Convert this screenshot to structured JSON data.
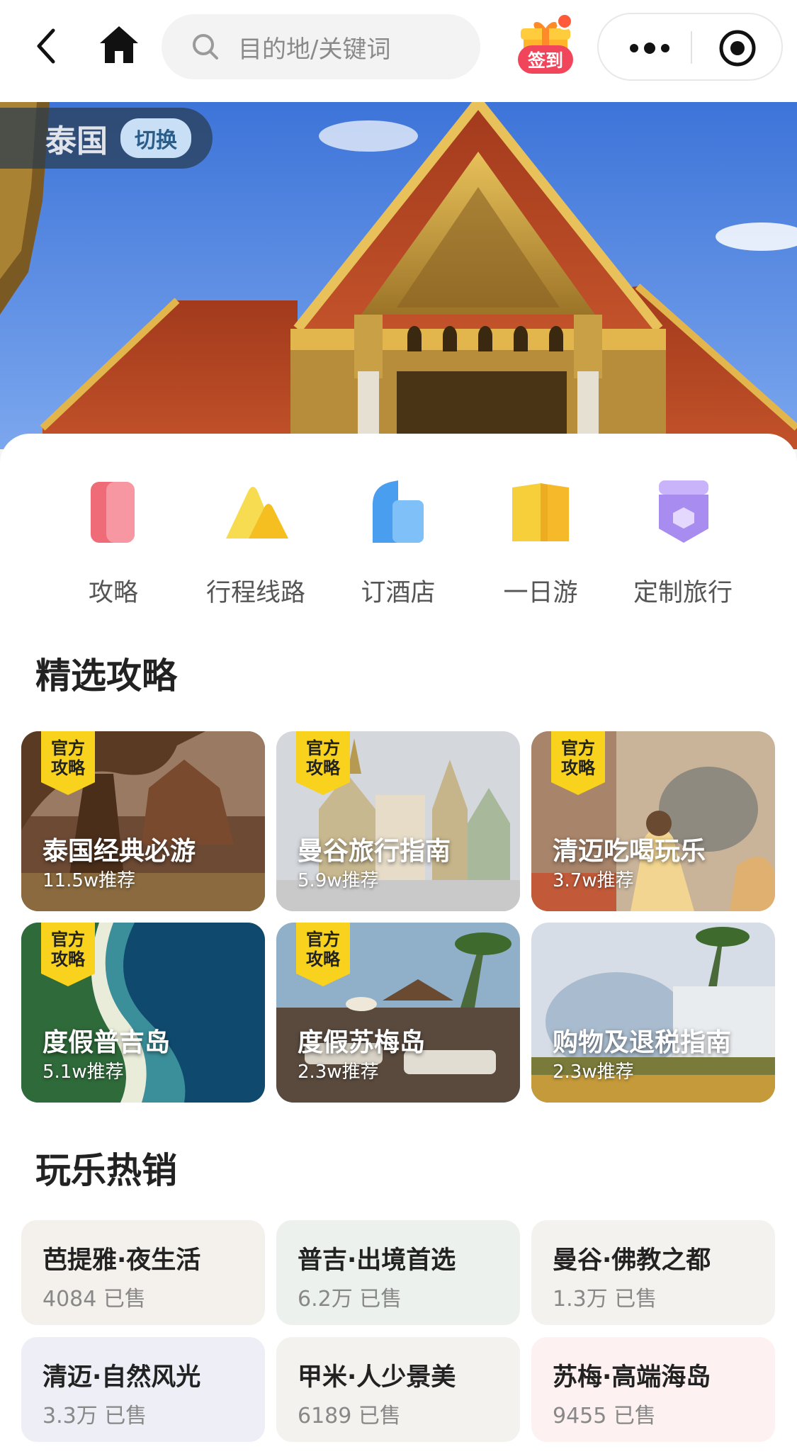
{
  "topbar": {
    "search_placeholder": "目的地/关键词",
    "signin_label": "签到"
  },
  "hero": {
    "country": "泰国",
    "switch_label": "切换"
  },
  "quick_nav": [
    {
      "label": "攻略",
      "icon": "guide-book-icon",
      "color": "#f06b78"
    },
    {
      "label": "行程线路",
      "icon": "route-mountain-icon",
      "color": "#f7cf3a"
    },
    {
      "label": "订酒店",
      "icon": "hotel-building-icon",
      "color": "#4a9ef0"
    },
    {
      "label": "一日游",
      "icon": "day-trip-map-icon",
      "color": "#f7cc2e"
    },
    {
      "label": "定制旅行",
      "icon": "custom-travel-icon",
      "color": "#a98cf0"
    }
  ],
  "sections": {
    "guides_title": "精选攻略",
    "play_title": "玩乐热销"
  },
  "guides": [
    {
      "title": "泰国经典必游",
      "count": "11.5w推荐",
      "badge": "官方攻略",
      "official": true
    },
    {
      "title": "曼谷旅行指南",
      "count": "5.9w推荐",
      "badge": "官方攻略",
      "official": true
    },
    {
      "title": "清迈吃喝玩乐",
      "count": "3.7w推荐",
      "badge": "官方攻略",
      "official": true
    },
    {
      "title": "度假普吉岛",
      "count": "5.1w推荐",
      "badge": "官方攻略",
      "official": true
    },
    {
      "title": "度假苏梅岛",
      "count": "2.3w推荐",
      "badge": "官方攻略",
      "official": true
    },
    {
      "title": "购物及退税指南",
      "count": "2.3w推荐",
      "badge": "",
      "official": false
    }
  ],
  "play": [
    {
      "title": "芭提雅·夜生活",
      "sold": "4084 已售",
      "bg": "#f4f1ec"
    },
    {
      "title": "普吉·出境首选",
      "sold": "6.2万 已售",
      "bg": "#edf1ee"
    },
    {
      "title": "曼谷·佛教之都",
      "sold": "1.3万 已售",
      "bg": "#f4f2ee"
    },
    {
      "title": "清迈·自然风光",
      "sold": "3.3万 已售",
      "bg": "#eeeef6"
    },
    {
      "title": "甲米·人少景美",
      "sold": "6189 已售",
      "bg": "#f4f2ee"
    },
    {
      "title": "苏梅·高端海岛",
      "sold": "9455 已售",
      "bg": "#fdf1f1"
    }
  ],
  "colors": {
    "accent_red": "#f0455a",
    "badge_yellow": "#f8d21c"
  }
}
